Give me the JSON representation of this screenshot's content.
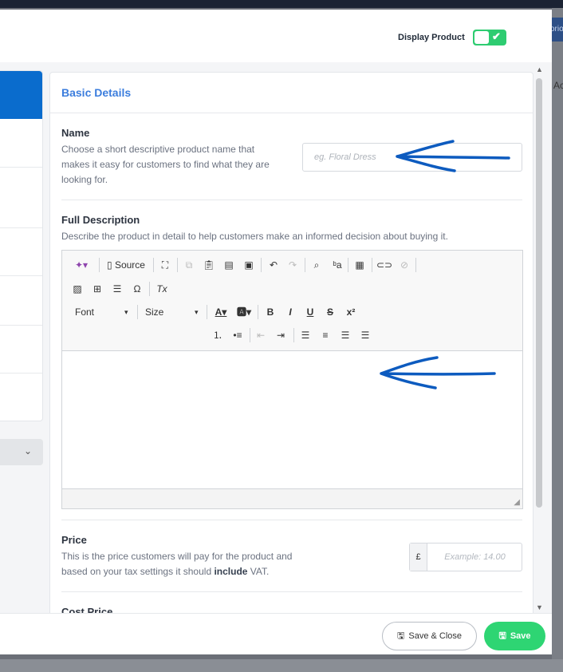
{
  "header": {
    "display_product_label": "Display Product",
    "display_product_on": true
  },
  "background": {
    "tab_text": "orio",
    "side_text": "Ac"
  },
  "card": {
    "title": "Basic Details",
    "name": {
      "title": "Name",
      "help": "Choose a short descriptive product name that makes it easy for customers to find what they are looking for.",
      "placeholder": "eg. Floral Dress",
      "value": ""
    },
    "description": {
      "title": "Full Description",
      "help": "Describe the product in detail to help customers make an informed decision about buying it.",
      "toolbar": {
        "source_label": "Source",
        "font_label": "Font",
        "size_label": "Size",
        "bold": "B",
        "italic": "I",
        "underline": "U",
        "strike": "S",
        "superscript": "x²",
        "clear_format": "Tx"
      }
    },
    "price": {
      "title": "Price",
      "help_prefix": "This is the price customers will pay for the product and based on your tax settings it should ",
      "help_bold": "include",
      "help_suffix": " VAT.",
      "currency": "£",
      "placeholder": "Example: 14.00",
      "value": ""
    },
    "cost_price": {
      "title": "Cost Price"
    }
  },
  "footer": {
    "save_close_label": "Save & Close",
    "save_label": "Save"
  },
  "colors": {
    "accent": "#3b7ddd",
    "toggle": "#2ecc71",
    "save": "#2ed573",
    "annotation_arrow": "#0d5bbf"
  },
  "icons": [
    "magic-icon",
    "source-icon",
    "maximize-icon",
    "copy-icon",
    "paste-icon",
    "paste-text-icon",
    "paste-word-icon",
    "undo-icon",
    "redo-icon",
    "find-icon",
    "replace-icon",
    "select-all-icon",
    "link-icon",
    "unlink-icon",
    "image-icon",
    "table-icon",
    "horizontal-rule-icon",
    "special-char-icon",
    "clear-format-icon",
    "text-color-icon",
    "bg-color-icon",
    "numbered-list-icon",
    "bulleted-list-icon",
    "outdent-icon",
    "indent-icon",
    "align-left-icon",
    "align-center-icon",
    "align-right-icon",
    "justify-icon",
    "floppy-icon",
    "check-icon",
    "chevron-down-icon",
    "arrow-annotation-icon"
  ]
}
